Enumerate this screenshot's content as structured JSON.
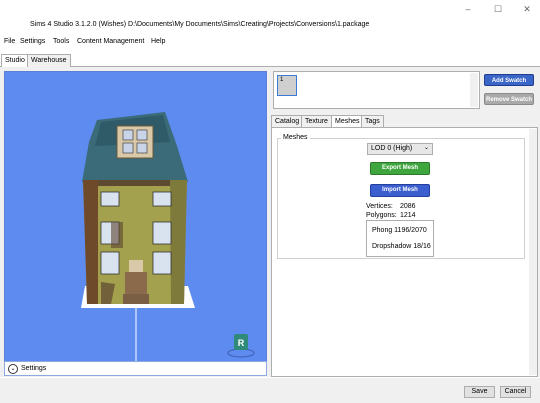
{
  "window": {
    "title": "Sims 4 Studio 3.1.2.0 (Wishes)  D:\\Documents\\My Documents\\Sims\\Creating\\Projects\\Conversions\\1.package",
    "minimize_glyph": "–",
    "maximize_glyph": "☐",
    "close_glyph": "✕"
  },
  "menu": {
    "items": [
      "File",
      "Settings",
      "Tools",
      "Content Management",
      "Help"
    ]
  },
  "top_tabs": [
    "Studio",
    "Warehouse"
  ],
  "viewport": {
    "settings_label": "Settings",
    "settings_glyph": "⌄",
    "badge_letter": "R",
    "background_color": "#5d8bef"
  },
  "swatches": {
    "items": [
      {
        "number": "1"
      }
    ],
    "add_label": "Add Swatch",
    "remove_label": "Remove Swatch"
  },
  "right_tabs": [
    "Catalog",
    "Texture",
    "Meshes",
    "Tags"
  ],
  "meshes": {
    "group_label": "Meshes",
    "lod_selected": "LOD 0 (High)",
    "export_label": "Export Mesh",
    "import_label": "Import Mesh",
    "vertices_label": "Vertices:",
    "vertices_value": "2086",
    "polygons_label": "Polygons:",
    "polygons_value": "1214",
    "shaders": [
      "Phong 1196/2070",
      "Dropshadow 18/16"
    ]
  },
  "footer": {
    "save_label": "Save",
    "cancel_label": "Cancel"
  },
  "colors": {
    "accent_blue": "#3b66c8",
    "export_green": "#3fa63f",
    "viewport_blue": "#5d8bef"
  }
}
